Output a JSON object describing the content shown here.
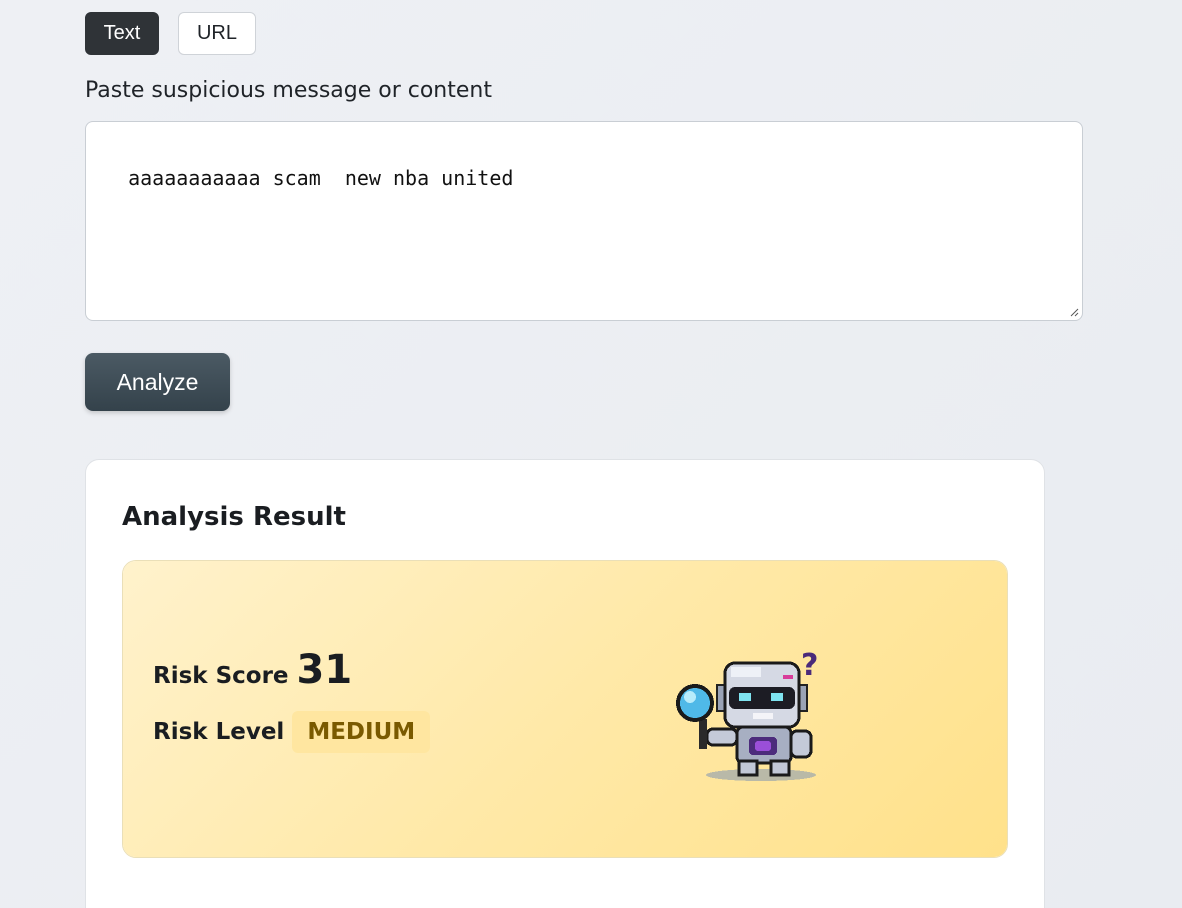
{
  "input_mode_tabs": [
    {
      "label": "Text",
      "active": true
    },
    {
      "label": "URL",
      "active": false
    }
  ],
  "message_field": {
    "label": "Paste suspicious message or content",
    "value": "aaaaaaaaaaa scam  new nba united"
  },
  "analyze_button": {
    "label": "Analyze"
  },
  "result": {
    "title": "Analysis Result",
    "risk_score_label": "Risk Score",
    "risk_score": "31",
    "risk_level_label": "Risk Level",
    "risk_level": "MEDIUM",
    "mascot_icon": "detective-robot-icon"
  },
  "colors": {
    "active_tab": "#2f3337",
    "analyze_button": "#3e4c55",
    "risk_banner": "#ffe9a8",
    "risk_badge_text": "#7a5a00"
  }
}
